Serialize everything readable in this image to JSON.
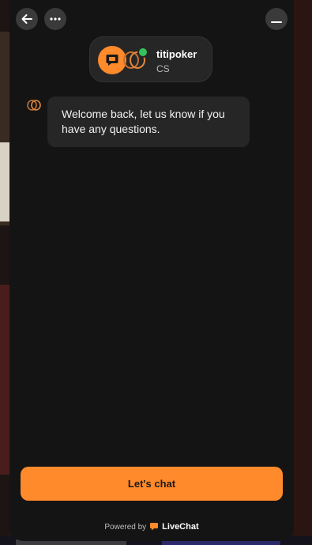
{
  "header": {
    "back_icon": "arrow-left-icon",
    "more_icon": "ellipsis-icon",
    "minimize_icon": "minimize-icon"
  },
  "agent": {
    "name": "titipoker",
    "role": "CS",
    "status": "online",
    "avatar_icon": "chat-bubble-icon",
    "logo_icon": "brand-rings-logo"
  },
  "messages": [
    {
      "text": "Welcome back, let us know if you have any questions.",
      "from": "agent"
    }
  ],
  "cta": {
    "label": "Let's chat"
  },
  "footer": {
    "powered_by": "Powered by",
    "brand": "LiveChat"
  },
  "colors": {
    "accent": "#ff8a2b",
    "background": "#141414",
    "bubble": "#262626",
    "online": "#35c25b"
  }
}
